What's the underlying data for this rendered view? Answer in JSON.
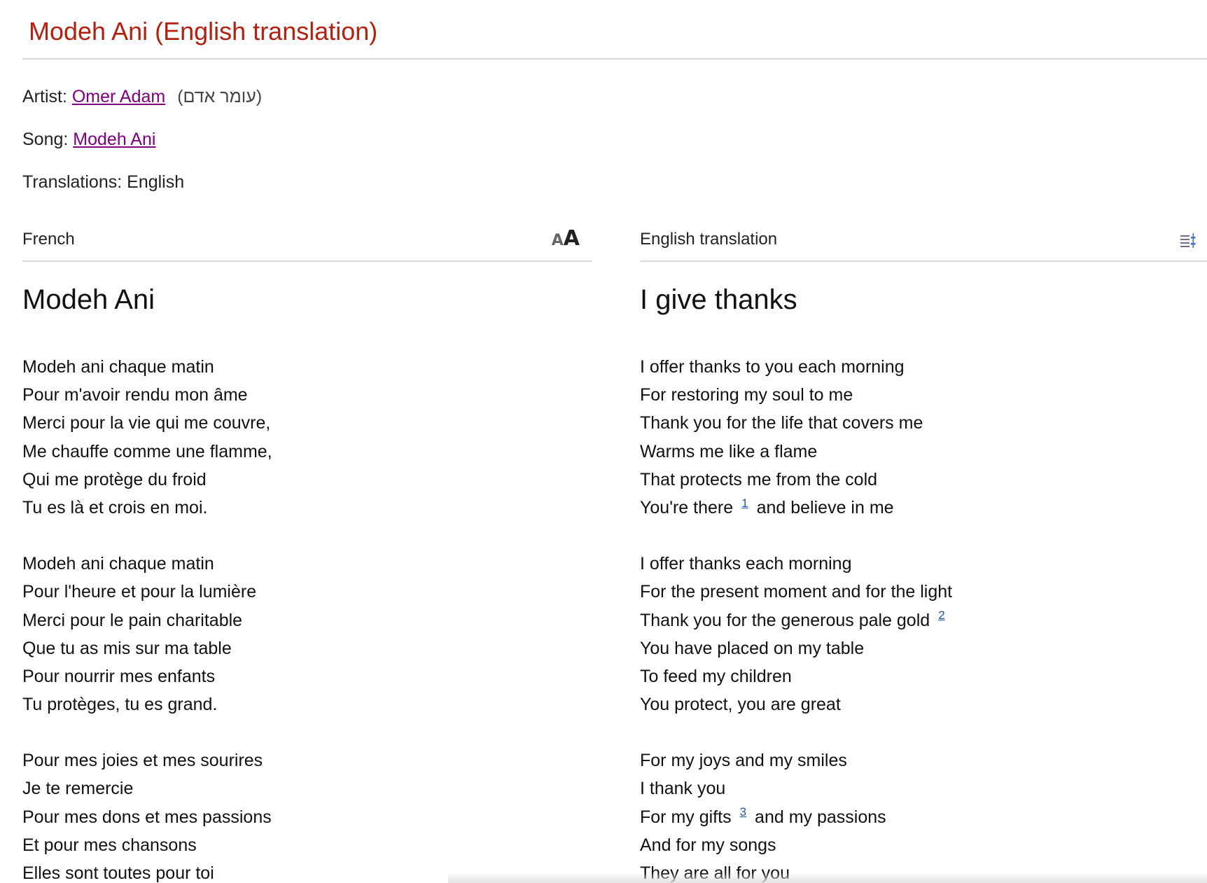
{
  "page": {
    "title": "Modeh Ani (English translation)"
  },
  "meta": {
    "artist_label": "Artist:",
    "artist_name": "Omer Adam",
    "artist_native": "(עומר אדם)",
    "song_label": "Song:",
    "song_name": "Modeh Ani",
    "translations_label": "Translations:",
    "translations_value": "English"
  },
  "original": {
    "language_label": "French",
    "font_size_icon": "font-size-icon",
    "title": "Modeh Ani",
    "stanzas": [
      [
        "Modeh ani chaque matin",
        "Pour m'avoir rendu mon âme",
        "Merci pour la vie qui me couvre,",
        "Me chauffe comme une flamme,",
        "Qui me protège du froid",
        "Tu es là et crois en moi."
      ],
      [
        "Modeh ani chaque matin",
        "Pour l'heure et pour la lumière",
        "Merci pour le pain charitable",
        "Que tu as mis sur ma table",
        "Pour nourrir mes enfants",
        "Tu protèges, tu es grand."
      ],
      [
        "Pour mes joies et mes sourires",
        "Je te remercie",
        "Pour mes dons et mes passions",
        "Et pour mes chansons",
        "Elles sont toutes pour toi"
      ]
    ]
  },
  "translation": {
    "language_label": "English translation",
    "settings_icon": "text-settings-icon",
    "title": "I give thanks",
    "stanzas": [
      [
        {
          "text": "I offer thanks to you each morning"
        },
        {
          "text": "For restoring my soul to me"
        },
        {
          "text": "Thank you for the life that covers me"
        },
        {
          "text": "Warms me like a flame"
        },
        {
          "text": "That protects me from the cold"
        },
        {
          "before": "You're there",
          "footnote": "1",
          "after": "and believe in me"
        }
      ],
      [
        {
          "text": "I offer thanks each morning"
        },
        {
          "text": "For the present moment and for the light"
        },
        {
          "before": "Thank you for the generous pale gold",
          "footnote": "2",
          "after": ""
        },
        {
          "text": "You have placed on my table"
        },
        {
          "text": "To feed my children"
        },
        {
          "text": "You protect, you are great"
        }
      ],
      [
        {
          "text": "For my joys and my smiles"
        },
        {
          "text": "I thank you"
        },
        {
          "before": "For my gifts",
          "footnote": "3",
          "after": "and my passions"
        },
        {
          "text": "And for my songs"
        },
        {
          "text": "They are all for you"
        }
      ]
    ]
  },
  "colors": {
    "title": "#b3200f",
    "link_visited": "#800080",
    "footnote_link": "#1a56b0"
  }
}
